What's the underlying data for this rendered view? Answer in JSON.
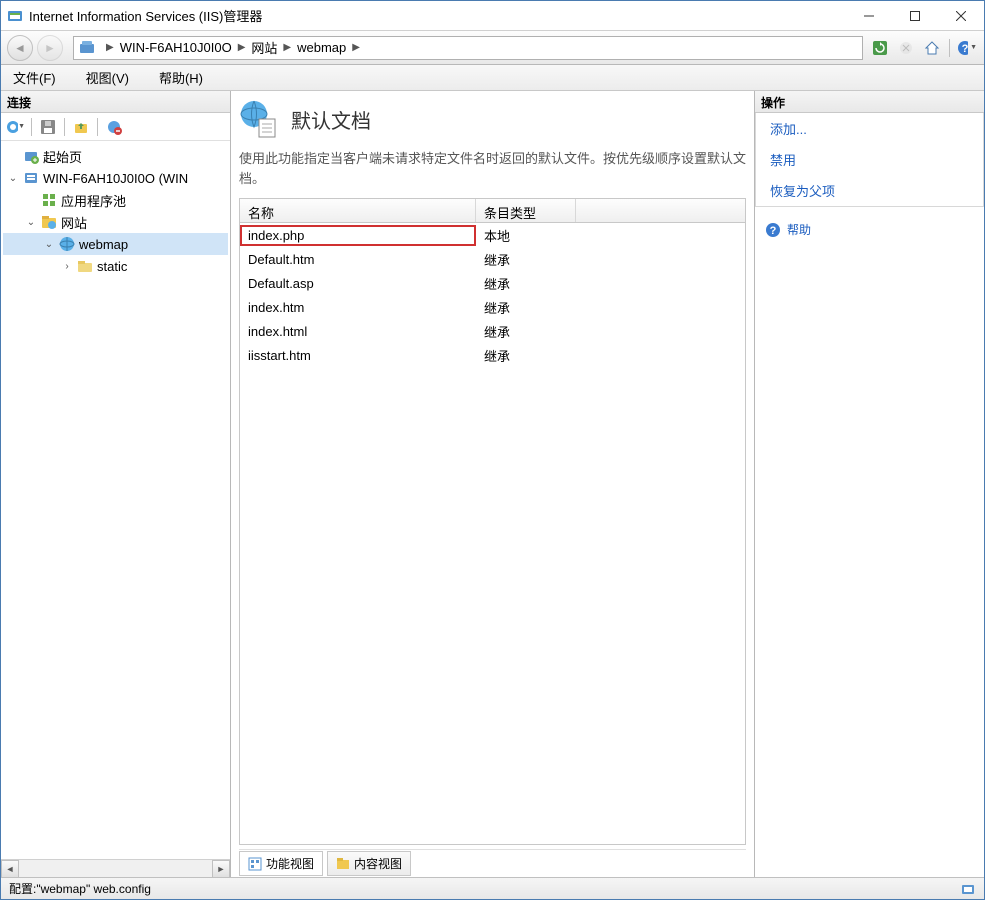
{
  "window": {
    "title": "Internet Information Services (IIS)管理器"
  },
  "breadcrumb": {
    "items": [
      "WIN-F6AH10J0I0O",
      "网站",
      "webmap"
    ]
  },
  "menu": {
    "file": "文件(F)",
    "view": "视图(V)",
    "help": "帮助(H)"
  },
  "left_pane": {
    "header": "连接",
    "tree": [
      {
        "label": "起始页",
        "indent": 0,
        "expander": "",
        "icon": "home"
      },
      {
        "label": "WIN-F6AH10J0I0O (WIN",
        "indent": 0,
        "expander": "v",
        "icon": "server"
      },
      {
        "label": "应用程序池",
        "indent": 1,
        "expander": "",
        "icon": "pool"
      },
      {
        "label": "网站",
        "indent": 1,
        "expander": "v",
        "icon": "sites"
      },
      {
        "label": "webmap",
        "indent": 2,
        "expander": "v",
        "icon": "site",
        "selected": true
      },
      {
        "label": "static",
        "indent": 3,
        "expander": ">",
        "icon": "folder"
      }
    ]
  },
  "center": {
    "title": "默认文档",
    "description": "使用此功能指定当客户端未请求特定文件名时返回的默认文件。按优先级顺序设置默认文档。",
    "columns": {
      "name": "名称",
      "type": "条目类型"
    },
    "rows": [
      {
        "name": "index.php",
        "type": "本地",
        "highlighted": true
      },
      {
        "name": "Default.htm",
        "type": "继承"
      },
      {
        "name": "Default.asp",
        "type": "继承"
      },
      {
        "name": "index.htm",
        "type": "继承"
      },
      {
        "name": "index.html",
        "type": "继承"
      },
      {
        "name": "iisstart.htm",
        "type": "继承"
      }
    ],
    "view_tabs": {
      "feature": "功能视图",
      "content": "内容视图"
    }
  },
  "right_pane": {
    "header": "操作",
    "actions": [
      {
        "label": "添加...",
        "key": "add"
      },
      {
        "label": "禁用",
        "key": "disable"
      },
      {
        "label": "恢复为父项",
        "key": "revert"
      }
    ],
    "help": "帮助"
  },
  "statusbar": {
    "config": "配置:\"webmap\" web.config"
  }
}
